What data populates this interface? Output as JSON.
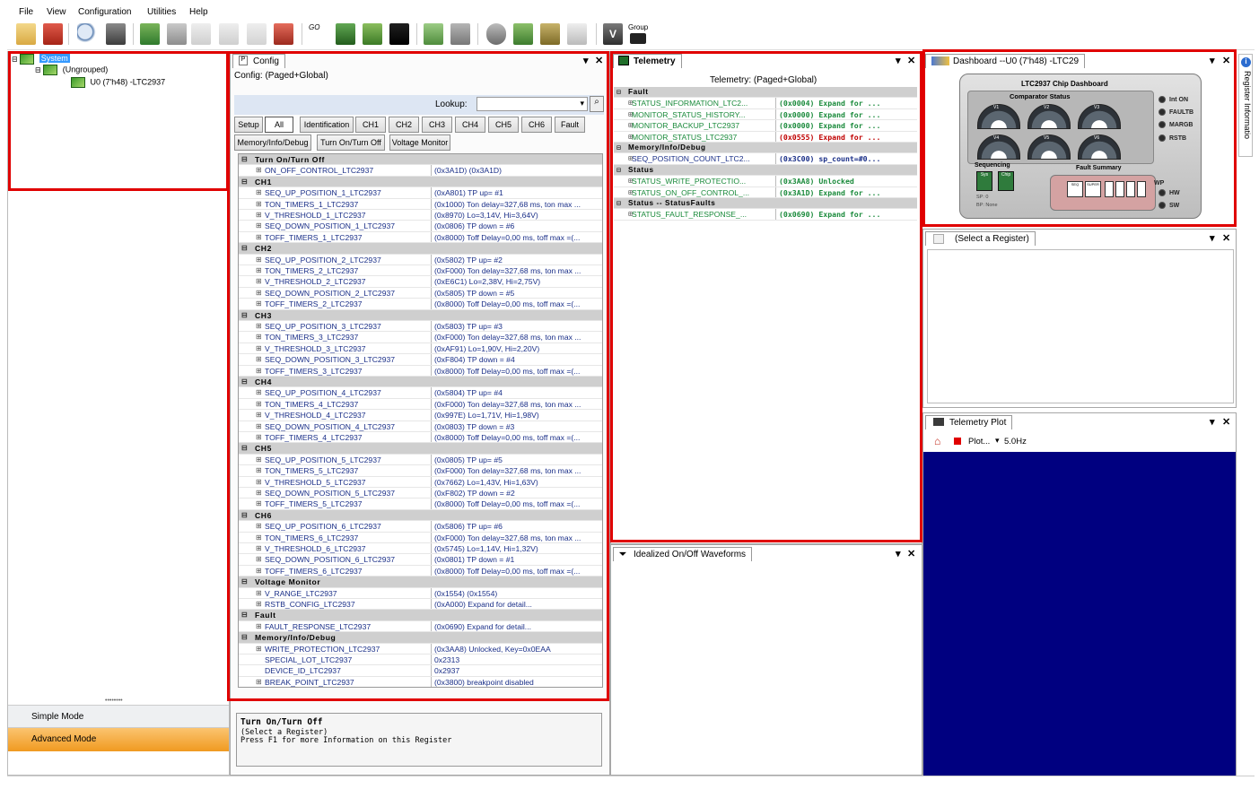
{
  "menu": [
    "File",
    "View",
    "Configuration",
    "Utilities",
    "Help"
  ],
  "toolbar": {
    "group_label": "Group",
    "goonline_label": "GO"
  },
  "tree": {
    "root": "System",
    "group": "(Ungrouped)",
    "device": "U0 (7'h48) -LTC2937"
  },
  "modes": {
    "simple": "Simple Mode",
    "advanced": "Advanced Mode"
  },
  "config": {
    "tab": "Config",
    "title": "Config:  (Paged+Global)",
    "lookup_label": "Lookup:",
    "filter_buttons": [
      "Setup",
      "All",
      "Identification",
      "CH1",
      "CH2",
      "CH3",
      "CH4",
      "CH5",
      "CH6",
      "Fault"
    ],
    "filter_buttons2": [
      "Memory/Info/Debug",
      "Turn On/Turn Off",
      "Voltage Monitor"
    ],
    "rows": [
      {
        "h": "Turn On/Turn Off"
      },
      {
        "n": "ON_OFF_CONTROL_LTC2937",
        "v": "(0x3A1D) (0x3A1D)"
      },
      {
        "h": "CH1"
      },
      {
        "n": "SEQ_UP_POSITION_1_LTC2937",
        "v": "(0xA801) TP up= #1"
      },
      {
        "n": "TON_TIMERS_1_LTC2937",
        "v": "(0x1000) Ton delay=327,68 ms, ton max ..."
      },
      {
        "n": "V_THRESHOLD_1_LTC2937",
        "v": "(0x8970) Lo=3,14V, Hi=3,64V)"
      },
      {
        "n": "SEQ_DOWN_POSITION_1_LTC2937",
        "v": "(0x0806) TP down = #6"
      },
      {
        "n": "TOFF_TIMERS_1_LTC2937",
        "v": "(0x8000) Toff Delay=0,00 ms, toff max =(..."
      },
      {
        "h": "CH2"
      },
      {
        "n": "SEQ_UP_POSITION_2_LTC2937",
        "v": "(0x5802) TP up= #2"
      },
      {
        "n": "TON_TIMERS_2_LTC2937",
        "v": "(0xF000) Ton delay=327,68 ms, ton max ..."
      },
      {
        "n": "V_THRESHOLD_2_LTC2937",
        "v": "(0xE6C1) Lo=2,38V, Hi=2,75V)"
      },
      {
        "n": "SEQ_DOWN_POSITION_2_LTC2937",
        "v": "(0x5805) TP down = #5"
      },
      {
        "n": "TOFF_TIMERS_2_LTC2937",
        "v": "(0x8000) Toff Delay=0,00 ms, toff max =(..."
      },
      {
        "h": "CH3"
      },
      {
        "n": "SEQ_UP_POSITION_3_LTC2937",
        "v": "(0x5803) TP up= #3"
      },
      {
        "n": "TON_TIMERS_3_LTC2937",
        "v": "(0xF000) Ton delay=327,68 ms, ton max ..."
      },
      {
        "n": "V_THRESHOLD_3_LTC2937",
        "v": "(0xAF91) Lo=1,90V, Hi=2,20V)"
      },
      {
        "n": "SEQ_DOWN_POSITION_3_LTC2937",
        "v": "(0xF804) TP down = #4"
      },
      {
        "n": "TOFF_TIMERS_3_LTC2937",
        "v": "(0x8000) Toff Delay=0,00 ms, toff max =(..."
      },
      {
        "h": "CH4"
      },
      {
        "n": "SEQ_UP_POSITION_4_LTC2937",
        "v": "(0x5804) TP up= #4"
      },
      {
        "n": "TON_TIMERS_4_LTC2937",
        "v": "(0xF000) Ton delay=327,68 ms, ton max ..."
      },
      {
        "n": "V_THRESHOLD_4_LTC2937",
        "v": "(0x997E) Lo=1,71V, Hi=1,98V)"
      },
      {
        "n": "SEQ_DOWN_POSITION_4_LTC2937",
        "v": "(0x0803) TP down = #3"
      },
      {
        "n": "TOFF_TIMERS_4_LTC2937",
        "v": "(0x8000) Toff Delay=0,00 ms, toff max =(..."
      },
      {
        "h": "CH5"
      },
      {
        "n": "SEQ_UP_POSITION_5_LTC2937",
        "v": "(0x0805) TP up= #5"
      },
      {
        "n": "TON_TIMERS_5_LTC2937",
        "v": "(0xF000) Ton delay=327,68 ms, ton max ..."
      },
      {
        "n": "V_THRESHOLD_5_LTC2937",
        "v": "(0x7662) Lo=1,43V, Hi=1,63V)"
      },
      {
        "n": "SEQ_DOWN_POSITION_5_LTC2937",
        "v": "(0xF802) TP down = #2"
      },
      {
        "n": "TOFF_TIMERS_5_LTC2937",
        "v": "(0x8000) Toff Delay=0,00 ms, toff max =(..."
      },
      {
        "h": "CH6"
      },
      {
        "n": "SEQ_UP_POSITION_6_LTC2937",
        "v": "(0x5806) TP up= #6"
      },
      {
        "n": "TON_TIMERS_6_LTC2937",
        "v": "(0xF000) Ton delay=327,68 ms, ton max ..."
      },
      {
        "n": "V_THRESHOLD_6_LTC2937",
        "v": "(0x5745) Lo=1,14V, Hi=1,32V)"
      },
      {
        "n": "SEQ_DOWN_POSITION_6_LTC2937",
        "v": "(0x0801) TP down = #1"
      },
      {
        "n": "TOFF_TIMERS_6_LTC2937",
        "v": "(0x8000) Toff Delay=0,00 ms, toff max =(..."
      },
      {
        "h": "Voltage Monitor"
      },
      {
        "n": "V_RANGE_LTC2937",
        "v": "(0x1554) (0x1554)"
      },
      {
        "n": "RSTB_CONFIG_LTC2937",
        "v": "(0xA000) Expand for detail..."
      },
      {
        "h": "Fault"
      },
      {
        "n": "FAULT_RESPONSE_LTC2937",
        "v": "(0x0690) Expand for detail..."
      },
      {
        "h": "Memory/Info/Debug"
      },
      {
        "n": "WRITE_PROTECTION_LTC2937",
        "v": "(0x3AA8) Unlocked, Key=0x0EAA"
      },
      {
        "n": "SPECIAL_LOT_LTC2937",
        "v": "0x2313",
        "noexp": true
      },
      {
        "n": "DEVICE_ID_LTC2937",
        "v": "0x2937",
        "noexp": true
      },
      {
        "n": "BREAK_POINT_LTC2937",
        "v": "(0x3800) breakpoint disabled"
      }
    ],
    "help_title": "Turn On/Turn Off",
    "help_line1": "(Select a Register)",
    "help_line2": "Press F1 for more Information on this Register"
  },
  "telemetry": {
    "tab": "Telemetry",
    "title": "Telemetry:  (Paged+Global)",
    "rows": [
      {
        "h": "Fault"
      },
      {
        "n": "STATUS_INFORMATION_LTC2...",
        "v": "(0x0004) Expand for ..."
      },
      {
        "n": "MONITOR_STATUS_HISTORY...",
        "v": "(0x0000) Expand for ..."
      },
      {
        "n": "MONITOR_BACKUP_LTC2937",
        "v": "(0x0000) Expand for ..."
      },
      {
        "n": "MONITOR_STATUS_LTC2937",
        "v": "(0x0555) Expand for ...",
        "red": true
      },
      {
        "h": "Memory/Info/Debug"
      },
      {
        "n": "SEQ_POSITION_COUNT_LTC2...",
        "v": "(0x3C00) sp_count=#0...",
        "blue": true
      },
      {
        "h": "Status"
      },
      {
        "n": "STATUS_WRITE_PROTECTIO...",
        "v": "(0x3AA8) Unlocked"
      },
      {
        "n": "STATUS_ON_OFF_CONTROL_...",
        "v": "(0x3A1D) Expand for ..."
      },
      {
        "h": "Status -- StatusFaults"
      },
      {
        "n": "STATUS_FAULT_RESPONSE_...",
        "v": "(0x0690) Expand for ..."
      }
    ]
  },
  "waveforms": {
    "tab": "Idealized On/Off Waveforms"
  },
  "dashboard": {
    "tab": "Dashboard --U0 (7'h48) -LTC29",
    "title": "LTC2937 Chip Dashboard",
    "comparator": "Comparator Status",
    "gauges": [
      "V1",
      "V2",
      "V3",
      "V4",
      "V5",
      "V6"
    ],
    "leds_right": [
      "Int ON",
      "FAULTB",
      "MARGB",
      "RSTB"
    ],
    "leds_low": [
      "HW",
      "SW"
    ],
    "wp_label": "WP",
    "sequencing": "Sequencing",
    "seq_buttons": [
      "Sys",
      "Chip"
    ],
    "sp": "SP: 0",
    "bp": "BP: None",
    "fault_summary": "Fault Summary",
    "fault_boxes": [
      "SEQ",
      "SUPER",
      "OV",
      "UV",
      "UV",
      "OV"
    ]
  },
  "register_info": {
    "tab": "(Select a Register)",
    "side": "Register Informatio"
  },
  "telemetry_plot": {
    "tab": "Telemetry Plot",
    "plot_label": "Plot...",
    "rate": "5.0Hz"
  },
  "colors": {
    "highlight": "#e00000",
    "plot_bg": "#000080",
    "advanced_mode": "#f5a332"
  }
}
